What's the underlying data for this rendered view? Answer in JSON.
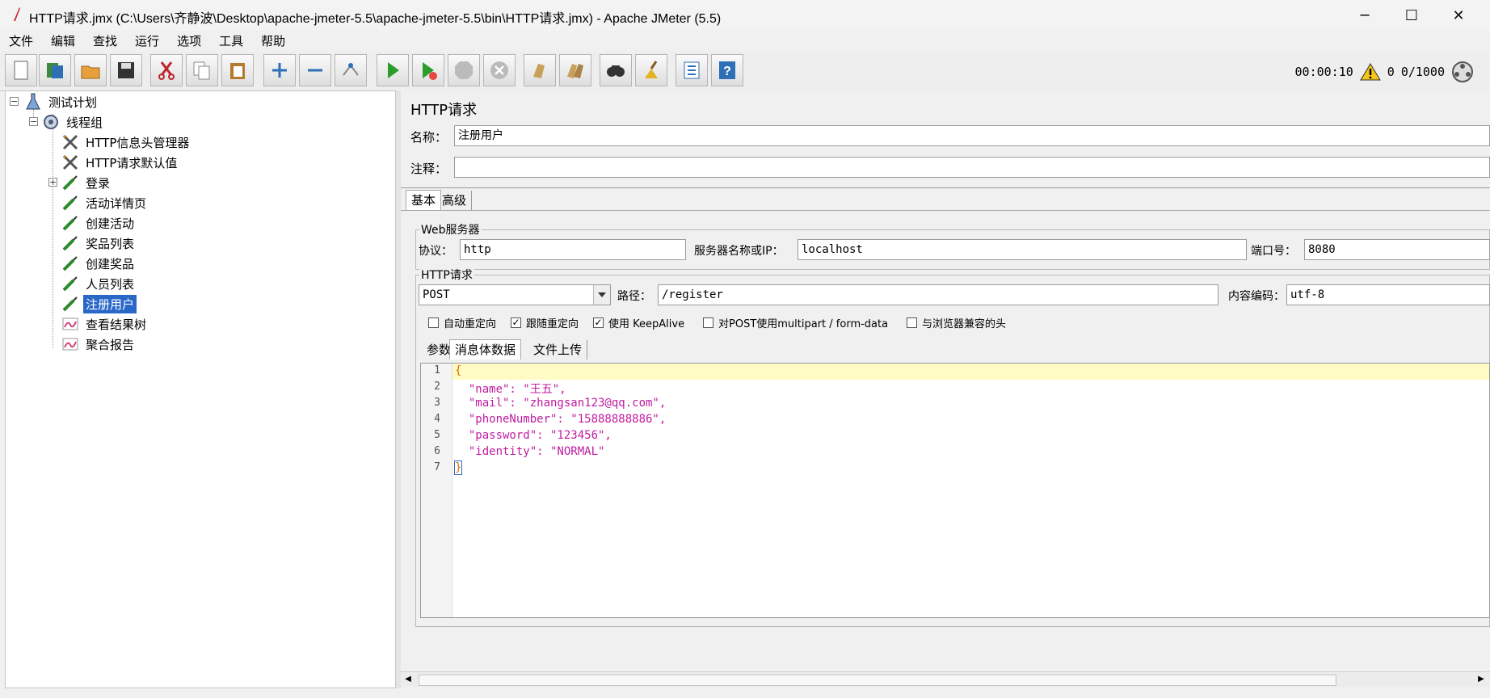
{
  "window": {
    "title": "HTTP请求.jmx (C:\\Users\\齐静波\\Desktop\\apache-jmeter-5.5\\apache-jmeter-5.5\\bin\\HTTP请求.jmx) - Apache JMeter (5.5)",
    "minimize": "─",
    "maximize": "☐",
    "close": "✕"
  },
  "menu": [
    "文件",
    "编辑",
    "查找",
    "运行",
    "选项",
    "工具",
    "帮助"
  ],
  "toolbar": {
    "buttons": [
      "new-icon",
      "templates-icon",
      "open-icon",
      "save-icon",
      "cut-icon",
      "copy-icon",
      "paste-icon",
      "expand-icon",
      "collapse-icon",
      "toggle-icon",
      "start-icon",
      "start-no-pause-icon",
      "stop-icon",
      "shutdown-icon",
      "clear-icon",
      "clear-all-icon",
      "search-icon",
      "reset-search-icon",
      "function-helper-icon",
      "help-icon"
    ],
    "timer": "00:00:10",
    "warnings": "0",
    "threads": "0/1000"
  },
  "tree": {
    "nodes": [
      {
        "label": "测试计划",
        "icon": "test-plan-icon",
        "level": 0
      },
      {
        "label": "线程组",
        "icon": "thread-group-icon",
        "level": 1
      },
      {
        "label": "HTTP信息头管理器",
        "icon": "config-tool-icon",
        "level": 2
      },
      {
        "label": "HTTP请求默认值",
        "icon": "config-tool-icon",
        "level": 2
      },
      {
        "label": "登录",
        "icon": "sampler-icon",
        "level": 2
      },
      {
        "label": "活动详情页",
        "icon": "sampler-icon",
        "level": 2
      },
      {
        "label": "创建活动",
        "icon": "sampler-icon",
        "level": 2
      },
      {
        "label": "奖品列表",
        "icon": "sampler-icon",
        "level": 2
      },
      {
        "label": "创建奖品",
        "icon": "sampler-icon",
        "level": 2
      },
      {
        "label": "人员列表",
        "icon": "sampler-icon",
        "level": 2
      },
      {
        "label": "注册用户",
        "icon": "sampler-icon",
        "level": 2,
        "selected": true
      },
      {
        "label": "查看结果树",
        "icon": "listener-icon",
        "level": 2
      },
      {
        "label": "聚合报告",
        "icon": "listener-icon",
        "level": 2
      }
    ]
  },
  "panel": {
    "title": "HTTP请求",
    "name_label": "名称：",
    "name_value": "注册用户",
    "comment_label": "注释：",
    "comment_value": "",
    "tabs": [
      "基本",
      "高级"
    ],
    "web_server": {
      "group_title": "Web服务器",
      "protocol_label": "协议：",
      "protocol_value": "http",
      "server_label": "服务器名称或IP：",
      "server_value": "localhost",
      "port_label": "端口号：",
      "port_value": "8080"
    },
    "http_request": {
      "group_title": "HTTP请求",
      "method_value": "POST",
      "path_label": "路径：",
      "path_value": "/register",
      "encoding_label": "内容编码：",
      "encoding_value": "utf-8",
      "checkboxes": [
        {
          "label": "自动重定向",
          "checked": false
        },
        {
          "label": "跟随重定向",
          "checked": true
        },
        {
          "label": "使用 KeepAlive",
          "checked": true
        },
        {
          "label": "对POST使用multipart / form-data",
          "checked": false
        },
        {
          "label": "与浏览器兼容的头",
          "checked": false
        }
      ],
      "sub_tabs": [
        "参数",
        "消息体数据",
        "文件上传"
      ]
    },
    "body_lines": [
      "{",
      "  \"name\": \"王五\",",
      "  \"mail\": \"zhangsan123@qq.com\",",
      "  \"phoneNumber\": \"15888888886\",",
      "  \"password\": \"123456\",",
      "  \"identity\": \"NORMAL\"",
      "}"
    ]
  }
}
